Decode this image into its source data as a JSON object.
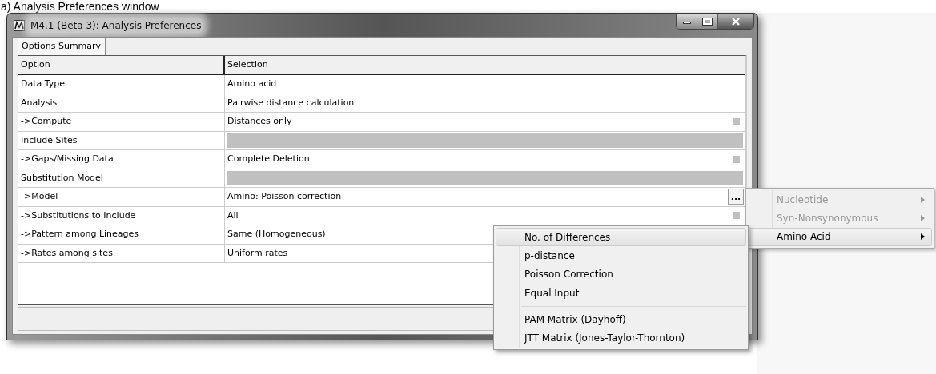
{
  "caption": "a) Analysis Preferences window",
  "window": {
    "title": "M4.1 (Beta 3): Analysis Preferences"
  },
  "tabs": [
    {
      "label": "Options Summary",
      "selected": true
    }
  ],
  "table": {
    "columns": [
      "Option",
      "Selection"
    ],
    "rows": [
      {
        "kind": "option",
        "option": "Data Type",
        "selection": "Amino acid"
      },
      {
        "kind": "option",
        "option": "Analysis",
        "selection": "Pairwise distance calculation"
      },
      {
        "kind": "square",
        "option": "->Compute",
        "selection": "Distances only"
      },
      {
        "kind": "section",
        "option": "Include Sites"
      },
      {
        "kind": "square",
        "option": "->Gaps/Missing Data",
        "selection": "Complete Deletion"
      },
      {
        "kind": "section",
        "option": "Substitution Model"
      },
      {
        "kind": "ellipsis",
        "option": "->Model",
        "selection": "Amino: Poisson correction",
        "button_label": "..."
      },
      {
        "kind": "square",
        "option": "->Substitutions to Include",
        "selection": "All"
      },
      {
        "kind": "option",
        "option": "->Pattern among Lineages",
        "selection": "Same (Homogeneous)"
      },
      {
        "kind": "option",
        "option": "->Rates among sites",
        "selection": "Uniform rates"
      }
    ]
  },
  "menu": {
    "items": [
      {
        "label": "Nucleotide",
        "disabled": true,
        "selected": false,
        "has_submenu": true
      },
      {
        "label": "Syn-Nonsynonymous",
        "disabled": true,
        "selected": false,
        "has_submenu": true
      },
      {
        "label": "Amino Acid",
        "disabled": false,
        "selected": true,
        "has_submenu": true
      }
    ]
  },
  "submenu": {
    "items": [
      {
        "kind": "item",
        "label": "No. of Differences",
        "selected": true
      },
      {
        "kind": "item",
        "label": "p-distance",
        "selected": false
      },
      {
        "kind": "item",
        "label": "Poisson Correction",
        "selected": false
      },
      {
        "kind": "item",
        "label": "Equal Input",
        "selected": false
      },
      {
        "kind": "separator"
      },
      {
        "kind": "item",
        "label": "PAM Matrix (Dayhoff)",
        "selected": false
      },
      {
        "kind": "item",
        "label": "JTT Matrix (Jones-Taylor-Thornton)",
        "selected": false
      }
    ]
  }
}
